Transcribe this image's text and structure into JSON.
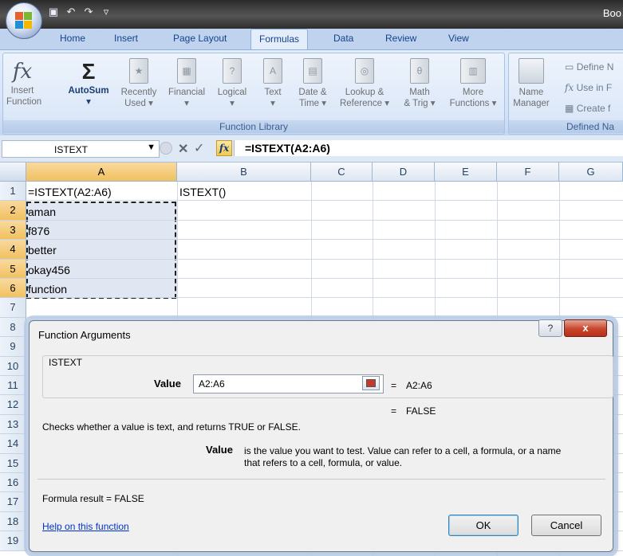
{
  "app": {
    "title": "Boo"
  },
  "tabs": [
    {
      "label": "Home"
    },
    {
      "label": "Insert"
    },
    {
      "label": "Page Layout"
    },
    {
      "label": "Formulas",
      "active": true
    },
    {
      "label": "Data"
    },
    {
      "label": "Review"
    },
    {
      "label": "View"
    }
  ],
  "ribbon": {
    "function_library": {
      "label": "Function Library",
      "buttons": [
        {
          "line1": "Insert",
          "line2": "Function",
          "icon": "fx-icon"
        },
        {
          "line1": "AutoSum",
          "line2": "▾",
          "icon": "sigma-icon"
        },
        {
          "line1": "Recently",
          "line2": "Used ▾",
          "icon": "book-star-icon"
        },
        {
          "line1": "Financial",
          "line2": "▾",
          "icon": "book-money-icon"
        },
        {
          "line1": "Logical",
          "line2": "▾",
          "icon": "book-question-icon"
        },
        {
          "line1": "Text",
          "line2": "▾",
          "icon": "book-a-icon"
        },
        {
          "line1": "Date &",
          "line2": "Time ▾",
          "icon": "book-calendar-icon"
        },
        {
          "line1": "Lookup &",
          "line2": "Reference ▾",
          "icon": "book-lookup-icon"
        },
        {
          "line1": "Math",
          "line2": "& Trig ▾",
          "icon": "book-theta-icon"
        },
        {
          "line1": "More",
          "line2": "Functions ▾",
          "icon": "books-icon"
        }
      ]
    },
    "defined_names": {
      "label": "Defined Na",
      "name_manager": {
        "line1": "Name",
        "line2": "Manager"
      },
      "define": "Define N",
      "use_in": "Use in F",
      "create": "Create f"
    }
  },
  "formula_bar": {
    "name_box": "ISTEXT",
    "formula": "=ISTEXT(A2:A6)"
  },
  "grid": {
    "columns": [
      "A",
      "B",
      "C",
      "D",
      "E",
      "F",
      "G"
    ],
    "rows": [
      "1",
      "2",
      "3",
      "4",
      "5",
      "6",
      "7",
      "8",
      "9",
      "10",
      "11",
      "12",
      "13",
      "14",
      "15",
      "16",
      "17",
      "18",
      "19"
    ],
    "cells": {
      "A1": "=ISTEXT(A2:A6)",
      "B1": "ISTEXT()",
      "A2": "aman",
      "A3": "f876",
      "A4": "better",
      "A5": "okay456",
      "A6": "function"
    }
  },
  "dialog": {
    "title": "Function Arguments",
    "help_icon": "?",
    "close_icon": "x",
    "function_name": "ISTEXT",
    "arg_label": "Value",
    "arg_value": "A2:A6",
    "arg_eq": "=",
    "arg_result": "A2:A6",
    "result_eq": "=",
    "result_value": "FALSE",
    "description": "Checks whether a value is text, and returns TRUE or FALSE.",
    "param_name": "Value",
    "param_desc_line1": "is the value you want to test. Value can refer to a cell, a formula, or a name",
    "param_desc_line2": "that refers to a cell, formula, or value.",
    "formula_result": "Formula result =   FALSE",
    "help_link": "Help on this function",
    "ok": "OK",
    "cancel": "Cancel"
  }
}
